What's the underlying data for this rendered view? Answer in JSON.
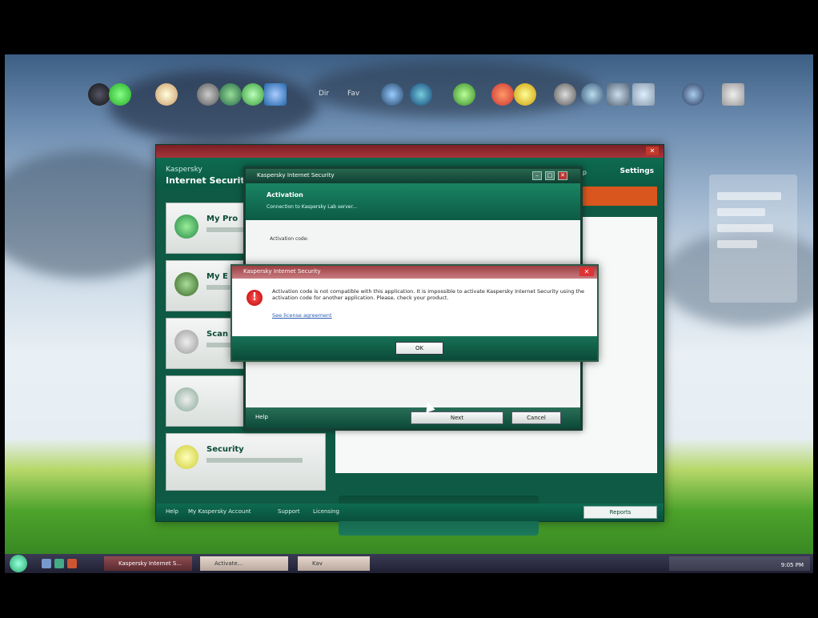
{
  "desktop": {
    "dock_labels": [
      "Dir",
      "Fav"
    ]
  },
  "main_window": {
    "brand_line1": "Kaspersky",
    "brand_line2": "Internet Security",
    "help_link": "Help",
    "settings_link": "Settings",
    "tiles": [
      {
        "label": "My Pro"
      },
      {
        "label": "My E"
      },
      {
        "label": "Scan"
      },
      {
        "label": ""
      },
      {
        "label": "Security"
      }
    ],
    "footer_links": [
      "Help",
      "My Kaspersky Account",
      "Support",
      "Licensing"
    ],
    "reports_button": "Reports"
  },
  "activation_dialog": {
    "title": "Kaspersky Internet Security",
    "header_title": "Activation",
    "header_subtitle": "Connection to Kaspersky Lab server...",
    "field_label": "Activation code:",
    "help_link": "Help",
    "next_button": "Next",
    "cancel_button": "Cancel"
  },
  "error_dialog": {
    "title": "Kaspersky Internet Security",
    "message": "Activation code is not compatible with this application. It is impossible to activate Kaspersky Internet Security using the activation code for another application. Please, check your product.",
    "link": "See license agreement",
    "ok_button": "OK"
  },
  "taskbar": {
    "items": [
      "Kaspersky Internet S...",
      "Activate...",
      "Kav"
    ],
    "clock": "9:05 PM"
  }
}
